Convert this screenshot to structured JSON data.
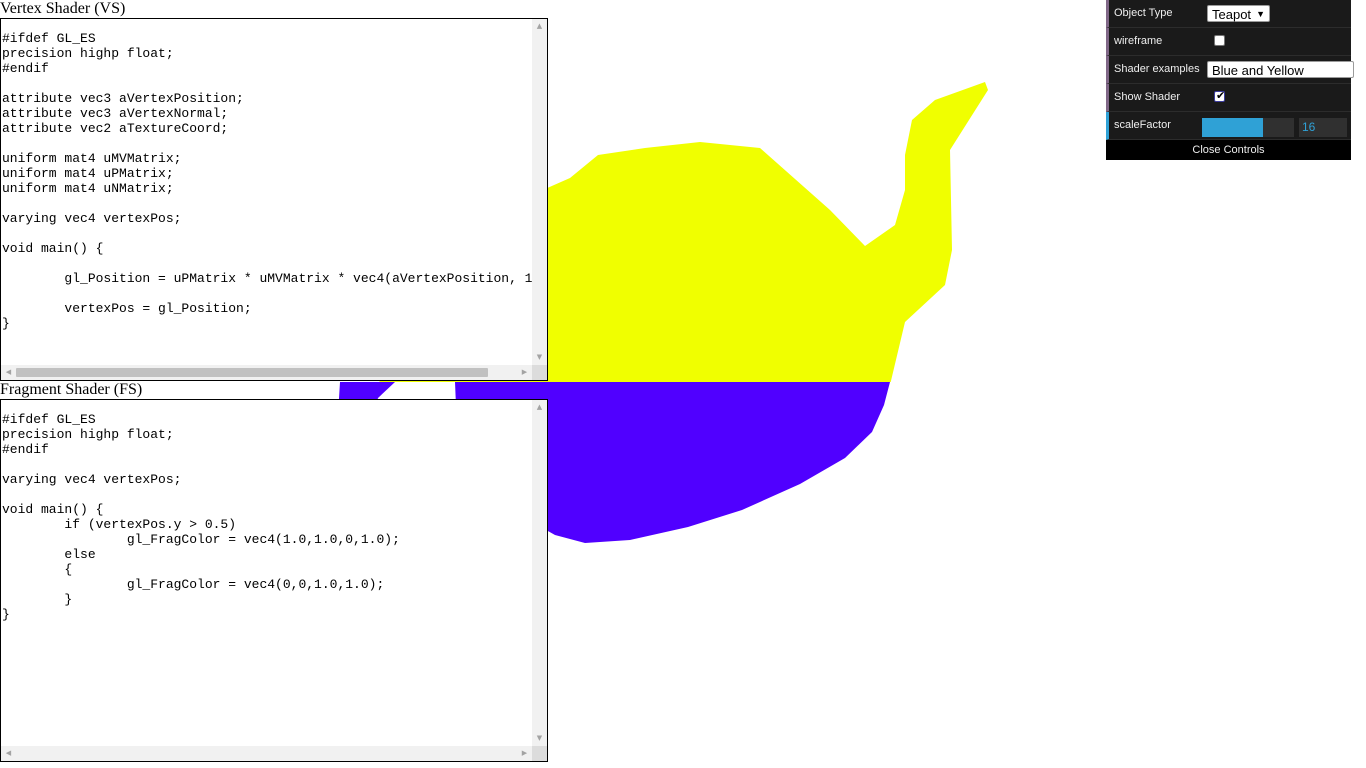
{
  "vertex_panel": {
    "title": "Vertex Shader (VS)",
    "code": "#ifdef GL_ES\nprecision highp float;\n#endif\n\nattribute vec3 aVertexPosition;\nattribute vec3 aVertexNormal;\nattribute vec2 aTextureCoord;\n\nuniform mat4 uMVMatrix;\nuniform mat4 uPMatrix;\nuniform mat4 uNMatrix;\n\nvarying vec4 vertexPos;\n\nvoid main() {\n\n        gl_Position = uPMatrix * uMVMatrix * vec4(aVertexPosition, 1\n\n        vertexPos = gl_Position;\n}"
  },
  "fragment_panel": {
    "title": "Fragment Shader (FS)",
    "code": "#ifdef GL_ES\nprecision highp float;\n#endif\n\nvarying vec4 vertexPos;\n\nvoid main() {\n        if (vertexPos.y > 0.5)\n                gl_FragColor = vec4(1.0,1.0,0,1.0);\n        else\n        {\n                gl_FragColor = vec4(0,0,1.0,1.0);\n        }\n}"
  },
  "scene": {
    "top_color": "#f0ff00",
    "bottom_color": "#5000ff"
  },
  "controls": {
    "object_type_label": "Object Type",
    "object_type_value": "Teapot",
    "wireframe_label": "wireframe",
    "wireframe_checked": false,
    "shader_examples_label": "Shader examples",
    "shader_examples_value": "Blue and Yellow",
    "show_shader_label": "Show Shader",
    "show_shader_checked": true,
    "scale_factor_label": "scaleFactor",
    "scale_factor_value": "16",
    "scale_factor_fraction": 0.66,
    "close_label": "Close Controls"
  },
  "icons": {
    "dropdown_arrow": "caret-down-icon",
    "scroll_up": "triangle-up-icon",
    "scroll_down": "triangle-down-icon",
    "scroll_left": "triangle-left-icon",
    "scroll_right": "triangle-right-icon"
  }
}
